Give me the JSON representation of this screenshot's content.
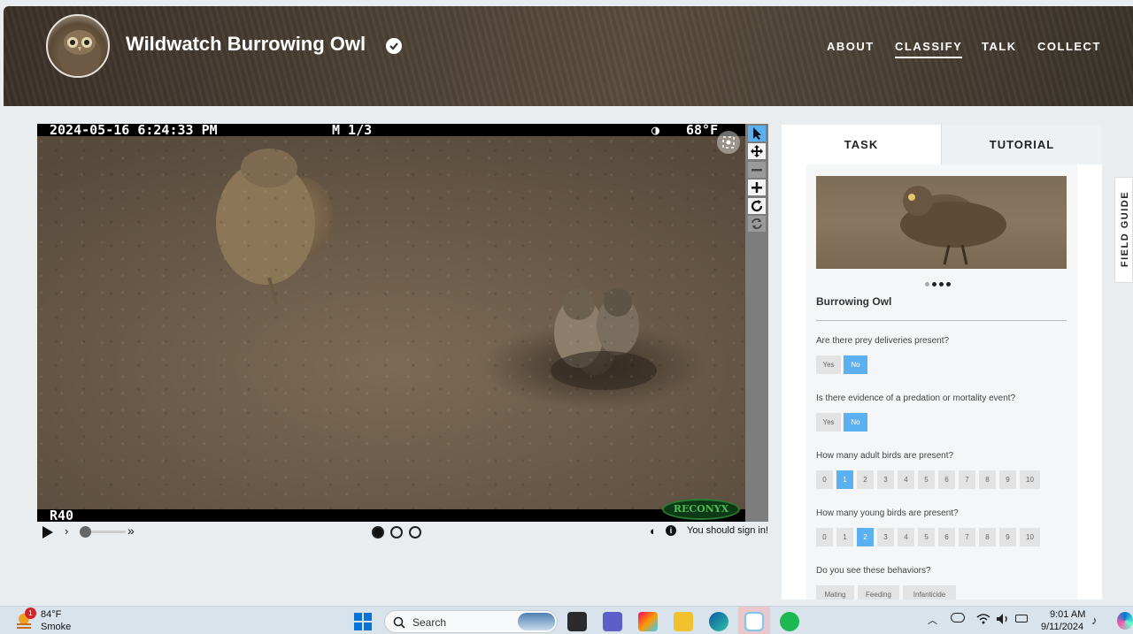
{
  "header": {
    "title": "Wildwatch Burrowing Owl",
    "nav": [
      "ABOUT",
      "CLASSIFY",
      "TALK",
      "COLLECT"
    ],
    "active_nav": "CLASSIFY"
  },
  "viewer": {
    "timestamp": "2024-05-16 6:24:33 PM",
    "frame": "M 1/3",
    "temperature": "68°F",
    "camera_id": "R40",
    "brand": "RECONYX",
    "signin_text": "You should sign in!",
    "tools": [
      "pointer-icon",
      "move-icon",
      "zoom-out-icon",
      "zoom-in-icon",
      "rotate-icon",
      "reset-icon"
    ],
    "frame_count": 3,
    "current_frame": 1
  },
  "panel": {
    "tabs": [
      "TASK",
      "TUTORIAL"
    ],
    "active_tab": "TASK",
    "choice_title": "Burrowing Owl",
    "questions": [
      {
        "text": "Are there prey deliveries present?",
        "options": [
          "Yes",
          "No"
        ],
        "selected": "No"
      },
      {
        "text": "Is there evidence of a predation or mortality event?",
        "options": [
          "Yes",
          "No"
        ],
        "selected": "No"
      },
      {
        "text": "How many adult birds are present?",
        "options": [
          "0",
          "1",
          "2",
          "3",
          "4",
          "5",
          "6",
          "7",
          "8",
          "9",
          "10"
        ],
        "selected": "1"
      },
      {
        "text": "How many young birds are present?",
        "options": [
          "0",
          "1",
          "2",
          "3",
          "4",
          "5",
          "6",
          "7",
          "8",
          "9",
          "10"
        ],
        "selected": "2"
      },
      {
        "text": "Do you see these behaviors?",
        "options": [
          "Mating",
          "Feeding",
          "Infanticide"
        ],
        "selected": ""
      }
    ],
    "field_guide": "FIELD GUIDE"
  },
  "taskbar": {
    "weather_temp": "84°F",
    "weather_desc": "Smoke",
    "weather_badge": "1",
    "search_placeholder": "Search",
    "time": "9:01 AM",
    "date": "9/11/2024"
  },
  "colors": {
    "accent": "#5ab0f0",
    "header_bg": "#4a3f34"
  }
}
